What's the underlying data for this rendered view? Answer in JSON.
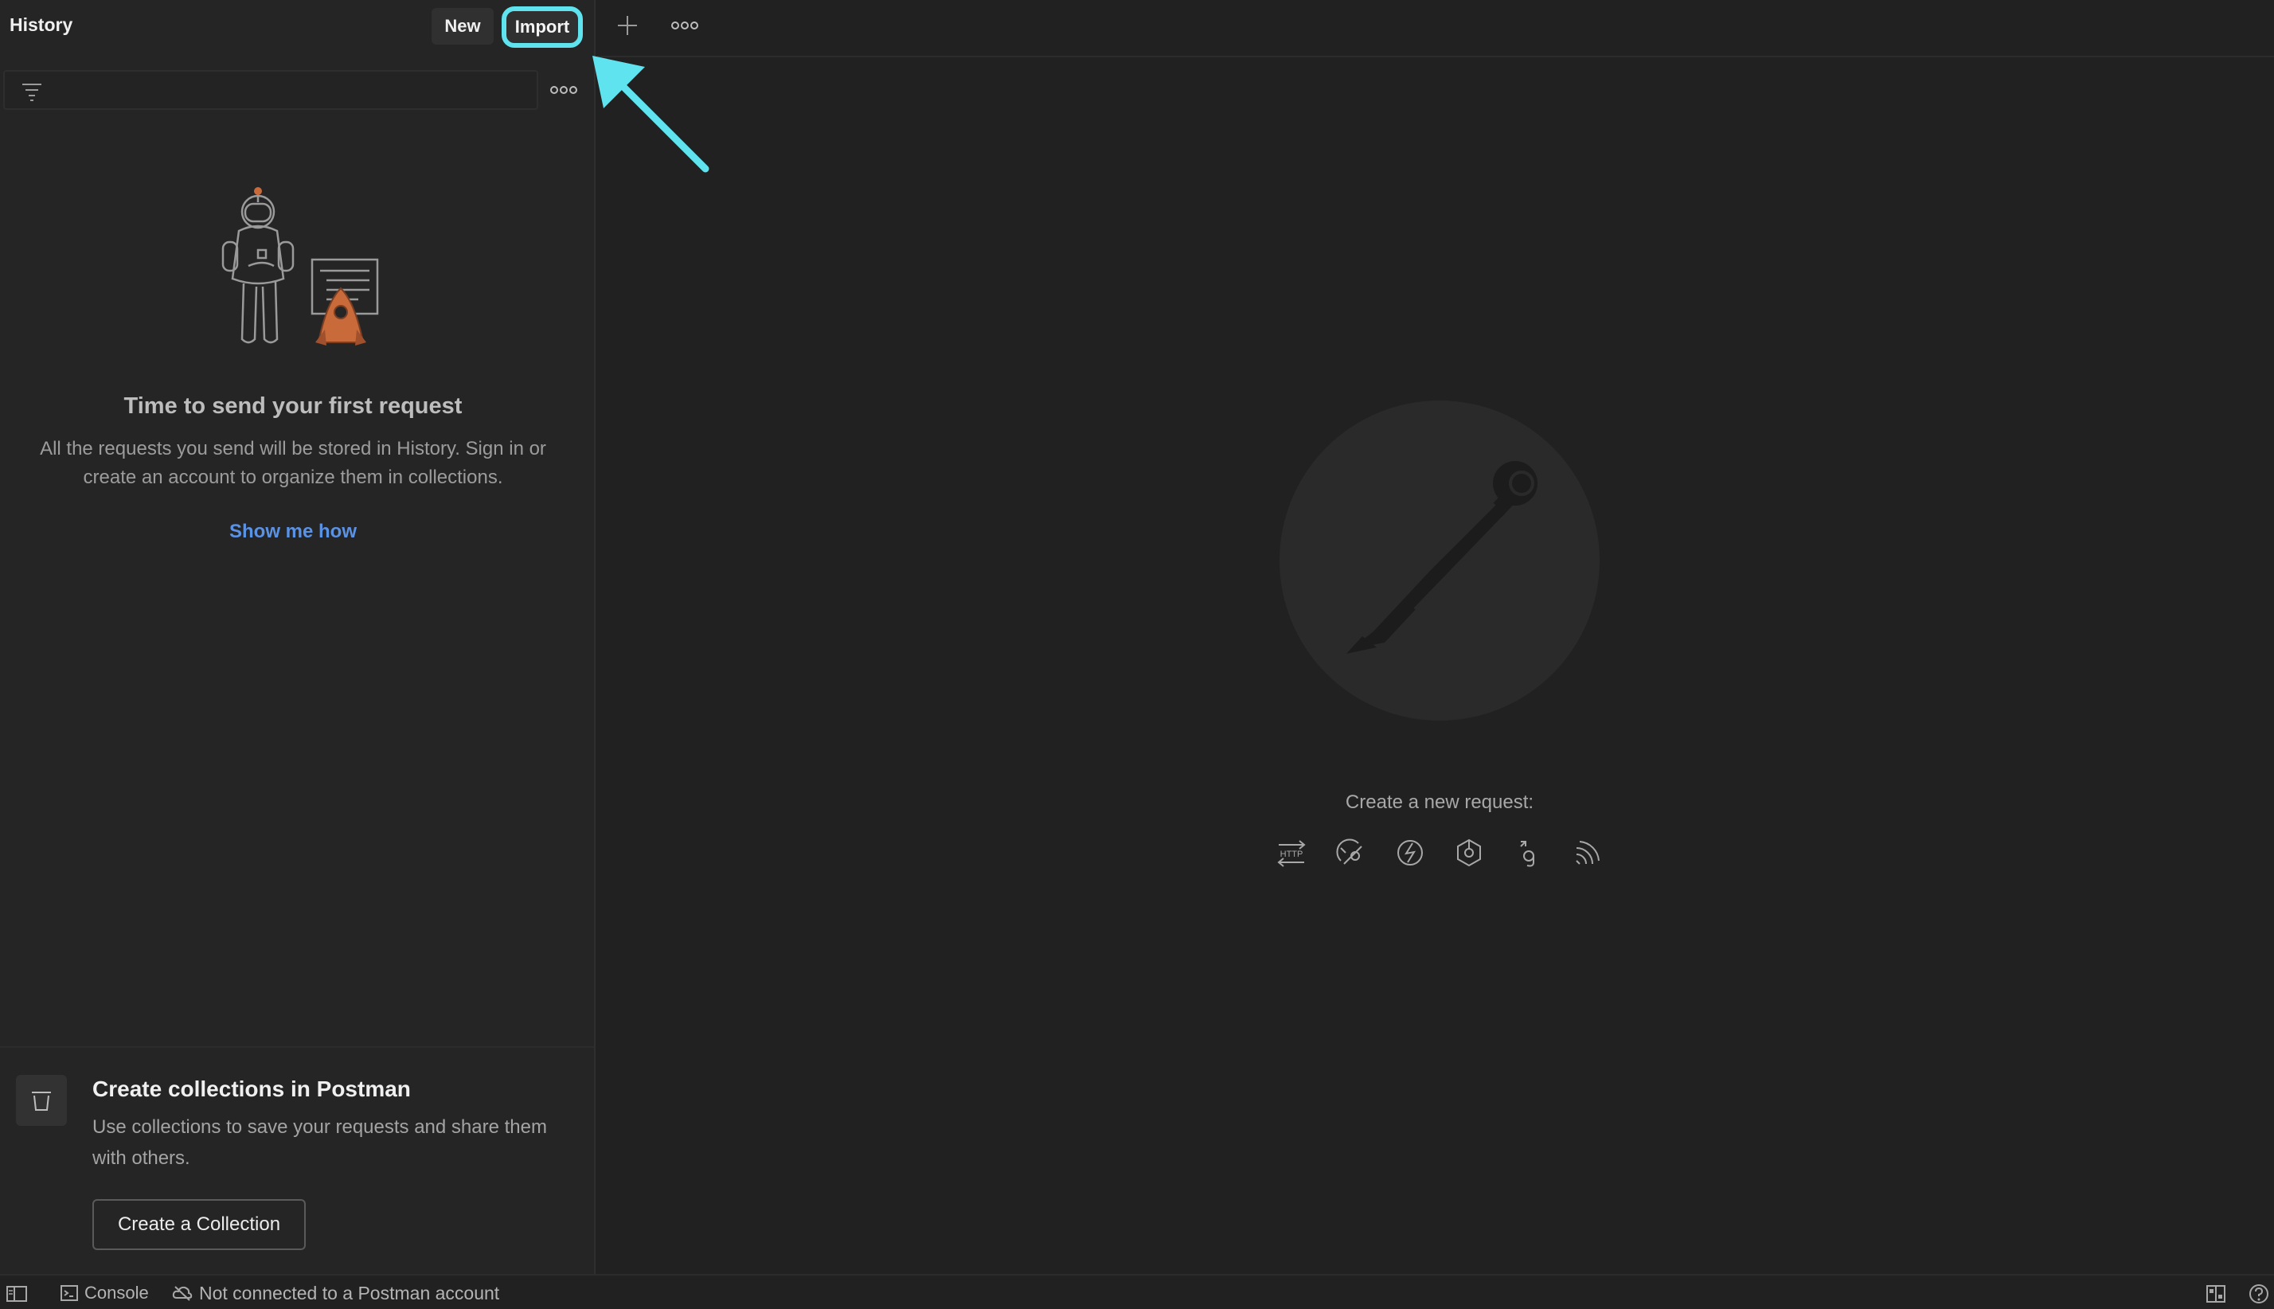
{
  "sidebar": {
    "title": "History",
    "new_label": "New",
    "import_label": "Import",
    "empty": {
      "title": "Time to send your first request",
      "description": "All the requests you send will be stored in History. Sign in or create an account to organize them in collections.",
      "link": "Show me how"
    },
    "collections": {
      "title": "Create collections in Postman",
      "description": "Use collections to save your requests and share them with others.",
      "button": "Create a Collection"
    }
  },
  "main": {
    "create_label": "Create a new request:",
    "request_types": [
      "http-icon",
      "graphql-icon",
      "websocket-icon",
      "socketio-icon",
      "grpc-icon",
      "mqtt-icon"
    ]
  },
  "statusbar": {
    "console": "Console",
    "connection": "Not connected to a Postman account"
  },
  "colors": {
    "background": "#212121",
    "sidebar": "#252525",
    "accent_link": "#5a92e6",
    "highlight": "#5fe3ef",
    "rocket": "#c96a3a"
  }
}
